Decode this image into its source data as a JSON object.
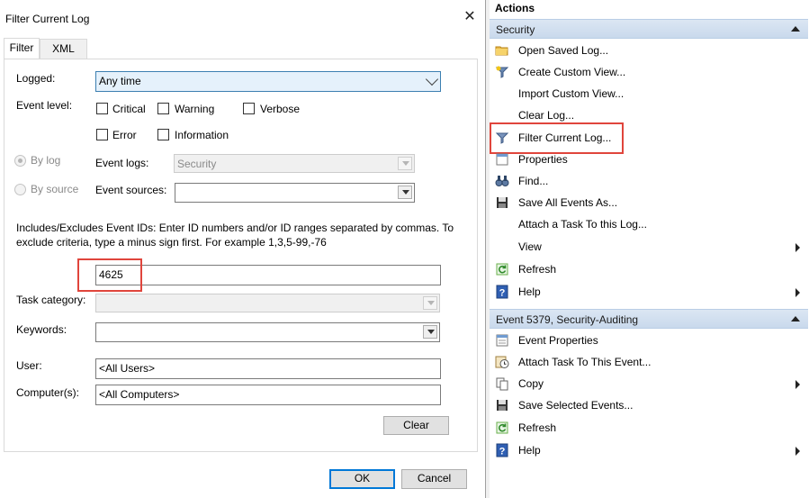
{
  "dialog": {
    "title": "Filter Current Log",
    "close_glyph": "✕",
    "tabs": [
      "Filter",
      "XML"
    ],
    "logged_label": "Logged:",
    "logged_value": "Any time",
    "event_level_label": "Event level:",
    "levels": [
      "Critical",
      "Warning",
      "Verbose",
      "Error",
      "Information"
    ],
    "by_log_label": "By log",
    "by_source_label": "By source",
    "event_logs_label": "Event logs:",
    "event_logs_value": "Security",
    "event_sources_label": "Event sources:",
    "event_sources_value": "",
    "instructions_line1": "Includes/Excludes Event IDs: Enter ID numbers and/or ID ranges separated by commas. To",
    "instructions_line2": "exclude criteria, type a minus sign first. For example 1,3,5-99,-76",
    "event_ids_value": "4625",
    "task_category_label": "Task category:",
    "keywords_label": "Keywords:",
    "user_label": "User:",
    "user_value": "<All Users>",
    "computer_label": "Computer(s):",
    "computer_value": "<All Computers>",
    "clear_label": "Clear",
    "ok_label": "OK",
    "cancel_label": "Cancel"
  },
  "actions": {
    "title": "Actions",
    "sections": [
      {
        "header": "Security",
        "items": [
          {
            "label": "Open Saved Log...",
            "icon": "folder-icon"
          },
          {
            "label": "Create Custom View...",
            "icon": "funnel-star-icon"
          },
          {
            "label": "Import Custom View...",
            "icon": ""
          },
          {
            "label": "Clear Log...",
            "icon": ""
          },
          {
            "label": "Filter Current Log...",
            "icon": "filter-icon"
          },
          {
            "label": "Properties",
            "icon": "properties-icon"
          },
          {
            "label": "Find...",
            "icon": "binoculars-icon"
          },
          {
            "label": "Save All Events As...",
            "icon": "save-icon"
          },
          {
            "label": "Attach a Task To this Log...",
            "icon": ""
          },
          {
            "label": "View",
            "icon": ""
          },
          {
            "label": "Refresh",
            "icon": "refresh-icon"
          },
          {
            "label": "Help",
            "icon": "help-icon"
          }
        ]
      },
      {
        "header": "Event 5379, Security-Auditing",
        "items": [
          {
            "label": "Event Properties",
            "icon": "event-properties-icon"
          },
          {
            "label": "Attach Task To This Event...",
            "icon": "task-clock-icon"
          },
          {
            "label": "Copy",
            "icon": "copy-icon"
          },
          {
            "label": "Save Selected Events...",
            "icon": "save-icon"
          },
          {
            "label": "Refresh",
            "icon": "refresh-icon"
          },
          {
            "label": "Help",
            "icon": "help-icon"
          }
        ]
      }
    ]
  },
  "colors": {
    "highlight_red": "#e0453c",
    "focus_blue": "#0078d7",
    "section_header": "#c9d9ec"
  }
}
